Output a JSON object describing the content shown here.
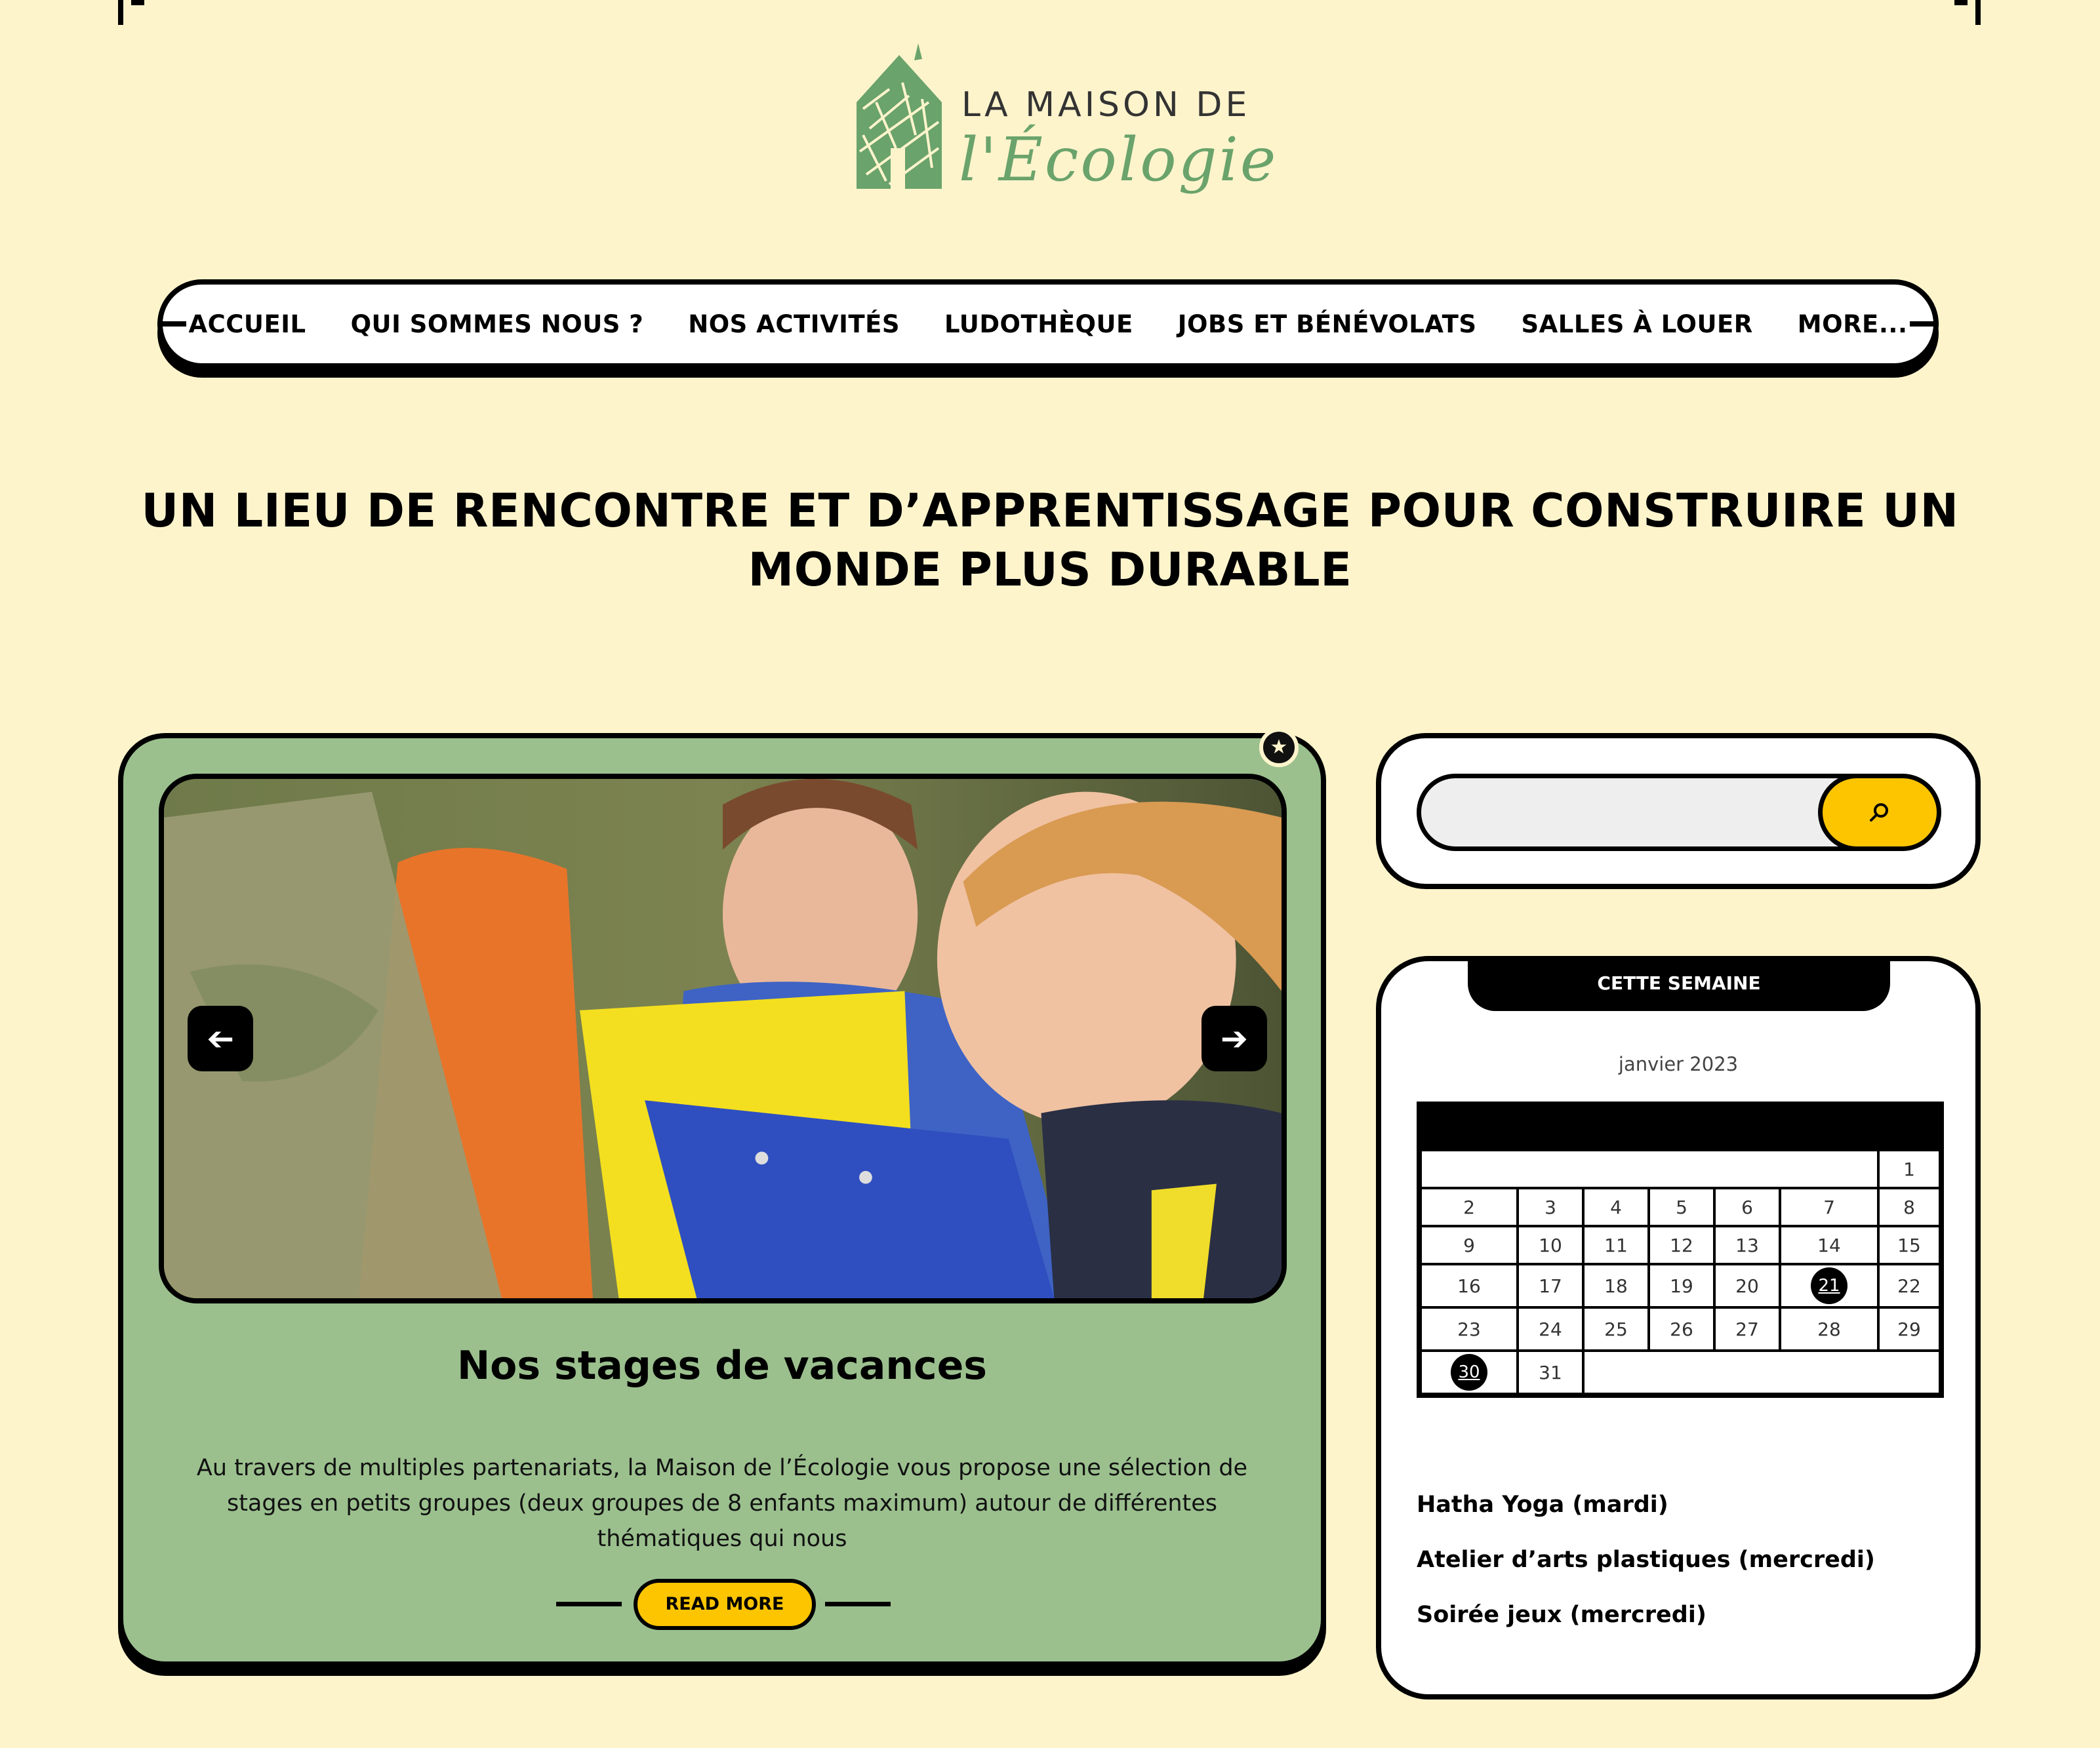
{
  "brand": {
    "name_top": "LA MAISON DE",
    "name_bottom": "l'Écologie",
    "color": "#6aa36b"
  },
  "nav": {
    "items": [
      {
        "label": "ACCUEIL"
      },
      {
        "label": "QUI SOMMES NOUS ?"
      },
      {
        "label": "NOS ACTIVITÉS"
      },
      {
        "label": "LUDOTHÈQUE"
      },
      {
        "label": "JOBS ET BÉNÉVOLATS"
      },
      {
        "label": "SALLES À LOUER"
      },
      {
        "label": "MORE..."
      }
    ]
  },
  "hero": {
    "headline": "UN LIEU DE RENCONTRE ET D’APPRENTISSAGE POUR CONSTRUIRE UN MONDE PLUS DURABLE"
  },
  "featured": {
    "badge_icon": "star-icon",
    "image_alt": "children-with-clipboards-photo",
    "prev_icon": "arrow-left-icon",
    "next_icon": "arrow-right-icon",
    "title": "Nos stages de vacances",
    "body": "Au travers de multiples partenariats, la Maison de l’Écologie vous propose une sélection de stages en petits groupes (deux groupes de 8 enfants maximum) autour de différentes thématiques qui nous",
    "read_more": "READ MORE",
    "background": "#9bc08e",
    "accent": "#fdc500"
  },
  "search": {
    "value": "",
    "placeholder": "",
    "button_icon": "search-icon"
  },
  "calendar": {
    "header": "CETTE SEMAINE",
    "month": "janvier 2023",
    "weeks": [
      [
        "",
        "",
        "",
        "",
        "",
        "",
        "1"
      ],
      [
        "2",
        "3",
        "4",
        "5",
        "6",
        "7",
        "8"
      ],
      [
        "9",
        "10",
        "11",
        "12",
        "13",
        "14",
        "15"
      ],
      [
        "16",
        "17",
        "18",
        "19",
        "20",
        "21",
        "22"
      ],
      [
        "23",
        "24",
        "25",
        "26",
        "27",
        "28",
        "29"
      ],
      [
        "30",
        "31",
        "",
        "",
        "",
        "",
        ""
      ]
    ],
    "highlighted_days": [
      "21",
      "30"
    ],
    "events": [
      {
        "label": "Hatha Yoga (mardi)"
      },
      {
        "label": "Atelier d’arts plastiques (mercredi)"
      },
      {
        "label": "Soirée jeux (mercredi)"
      }
    ]
  }
}
